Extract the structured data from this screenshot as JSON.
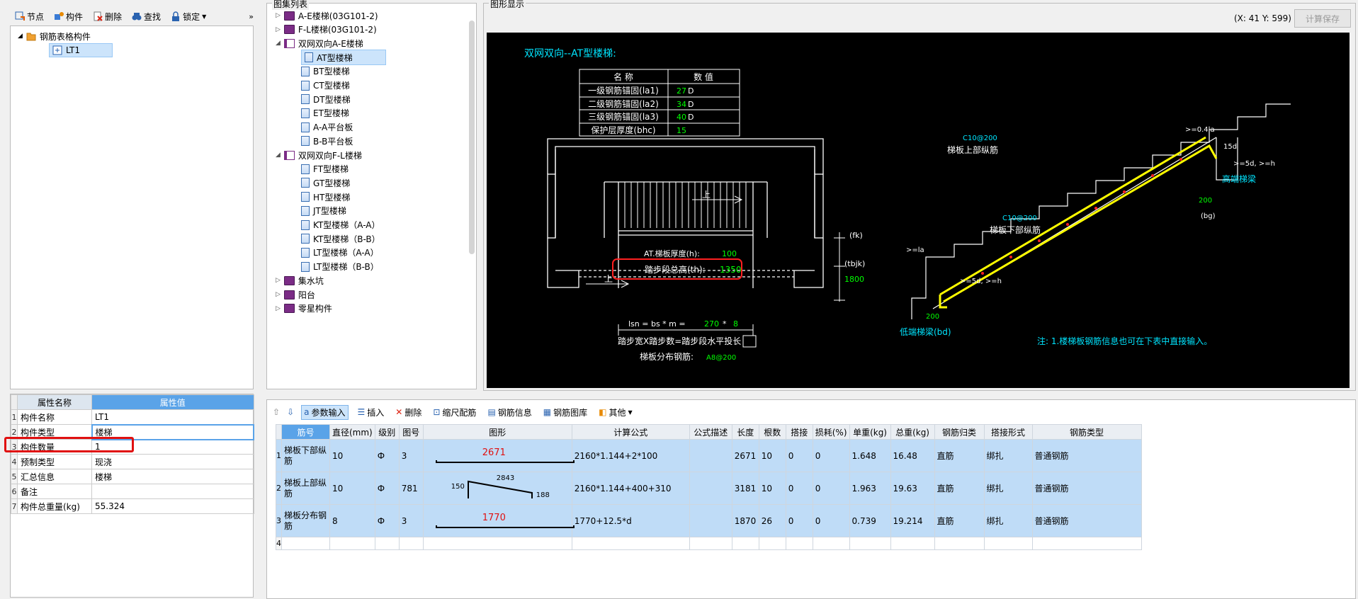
{
  "toolbar": {
    "node": "节点",
    "component": "构件",
    "delete": "删除",
    "find": "查找",
    "lock": "锁定"
  },
  "tree": {
    "root": "钢筋表格构件",
    "child": "LT1"
  },
  "props": {
    "col_name": "属性名称",
    "col_value": "属性值",
    "rows": [
      {
        "n": "1",
        "name": "构件名称",
        "value": "LT1"
      },
      {
        "n": "2",
        "name": "构件类型",
        "value": "楼梯"
      },
      {
        "n": "3",
        "name": "构件数量",
        "value": "1"
      },
      {
        "n": "4",
        "name": "预制类型",
        "value": "现浇"
      },
      {
        "n": "5",
        "name": "汇总信息",
        "value": "楼梯"
      },
      {
        "n": "6",
        "name": "备注",
        "value": ""
      },
      {
        "n": "7",
        "name": "构件总重量(kg)",
        "value": "55.324"
      }
    ]
  },
  "atlas": {
    "title": "图集列表",
    "items": [
      {
        "label": "A-E楼梯(03G101-2)",
        "kind": "book"
      },
      {
        "label": "F-L楼梯(03G101-2)",
        "kind": "book"
      },
      {
        "label": "双网双向A-E楼梯",
        "kind": "book-open"
      },
      {
        "label": "AT型楼梯",
        "kind": "doc",
        "selected": true
      },
      {
        "label": "BT型楼梯",
        "kind": "doc"
      },
      {
        "label": "CT型楼梯",
        "kind": "doc"
      },
      {
        "label": "DT型楼梯",
        "kind": "doc"
      },
      {
        "label": "ET型楼梯",
        "kind": "doc"
      },
      {
        "label": "A-A平台板",
        "kind": "doc"
      },
      {
        "label": "B-B平台板",
        "kind": "doc"
      },
      {
        "label": "双网双向F-L楼梯",
        "kind": "book-open"
      },
      {
        "label": "FT型楼梯",
        "kind": "doc"
      },
      {
        "label": "GT型楼梯",
        "kind": "doc"
      },
      {
        "label": "HT型楼梯",
        "kind": "doc"
      },
      {
        "label": "JT型楼梯",
        "kind": "doc"
      },
      {
        "label": "KT型楼梯（A-A）",
        "kind": "doc"
      },
      {
        "label": "KT型楼梯（B-B）",
        "kind": "doc"
      },
      {
        "label": "LT型楼梯（A-A）",
        "kind": "doc"
      },
      {
        "label": "LT型楼梯（B-B）",
        "kind": "doc"
      },
      {
        "label": "集水坑",
        "kind": "book"
      },
      {
        "label": "阳台",
        "kind": "book"
      },
      {
        "label": "零星构件",
        "kind": "book"
      }
    ]
  },
  "graphic": {
    "title": "图形显示",
    "coords": "(X: 41 Y: 599)",
    "save": "计算保存"
  },
  "drawing": {
    "heading": "双网双向--AT型楼梯:",
    "table_h_name": "名  称",
    "table_h_value": "数  值",
    "table_rows": [
      {
        "name": "一级钢筋锚固(la1)",
        "value": "27",
        "unit": "D"
      },
      {
        "name": "二级钢筋锚固(la2)",
        "value": "34",
        "unit": "D"
      },
      {
        "name": "三级钢筋锚固(la3)",
        "value": "40",
        "unit": "D"
      },
      {
        "name": "保护层厚度(bhc)",
        "value": "15",
        "unit": ""
      }
    ],
    "thick_label": "AT.梯板厚度(h):",
    "thick_value": "100",
    "height_label": "踏步段总高(th):",
    "height_value": "1350",
    "lsn_label": "lsn = bs * m =",
    "lsn_bs": "270",
    "lsn_star": "*",
    "lsn_m": "8",
    "lsn_caption": "踏步宽X踏步数=踏步段水平投长",
    "dist_label": "梯板分布钢筋:",
    "dist_value": "A8@200",
    "fk": "(fk)",
    "tbjk": "(tbjk)",
    "v1800": "1800",
    "up1": "上",
    "up2": "上",
    "top_rebar_spec": "C10@200",
    "top_rebar_label": "梯板上部纵筋",
    "bot_rebar_spec": "C10@200",
    "bot_rebar_label": "梯板下部纵筋",
    "ann_04la": ">=0.4la",
    "ann_15d": "15d",
    "ann_5d_h_top": ">=5d, >=h",
    "high_beam": "高端梯梁",
    "v200_top": "200",
    "bg": "(bg)",
    "ann_la": ">=la",
    "ann_5d_h_bot": ">=5d, >=h",
    "v200_bot": "200",
    "low_beam": "低端梯梁(bd)",
    "note": "注: 1.楼梯板钢筋信息也可在下表中直接输入。"
  },
  "grid_tools": {
    "param_input": "参数输入",
    "insert": "插入",
    "delete": "删除",
    "scale": "缩尺配筋",
    "info": "钢筋信息",
    "lib": "钢筋图库",
    "other": "其他"
  },
  "grid": {
    "headers": [
      "筋号",
      "直径(mm)",
      "级别",
      "图号",
      "图形",
      "计算公式",
      "公式描述",
      "长度",
      "根数",
      "搭接",
      "损耗(%)",
      "单重(kg)",
      "总重(kg)",
      "钢筋归类",
      "搭接形式",
      "钢筋类型"
    ],
    "rows": [
      {
        "n": "1",
        "name": "梯板下部纵筋",
        "dia": "10",
        "grade": "Ф",
        "fig": "3",
        "shape": "2671",
        "formula": "2160*1.144+2*100",
        "desc": "",
        "len": "2671",
        "count": "10",
        "lap": "0",
        "loss": "0",
        "unit": "1.648",
        "total": "16.48",
        "cat": "直筋",
        "lapform": "绑扎",
        "type": "普通钢筋"
      },
      {
        "n": "2",
        "name": "梯板上部纵筋",
        "dia": "10",
        "grade": "Ф",
        "fig": "781",
        "shape_a": "150",
        "shape_b": "2843",
        "shape_c": "188",
        "formula": "2160*1.144+400+310",
        "desc": "",
        "len": "3181",
        "count": "10",
        "lap": "0",
        "loss": "0",
        "unit": "1.963",
        "total": "19.63",
        "cat": "直筋",
        "lapform": "绑扎",
        "type": "普通钢筋"
      },
      {
        "n": "3",
        "name": "梯板分布钢筋",
        "dia": "8",
        "grade": "Ф",
        "fig": "3",
        "shape": "1770",
        "formula": "1770+12.5*d",
        "desc": "",
        "len": "1870",
        "count": "26",
        "lap": "0",
        "loss": "0",
        "unit": "0.739",
        "total": "19.214",
        "cat": "直筋",
        "lapform": "绑扎",
        "type": "普通钢筋"
      },
      {
        "n": "4",
        "name": "",
        "dia": "",
        "grade": "",
        "fig": "",
        "formula": "",
        "desc": "",
        "len": "",
        "count": "",
        "lap": "",
        "loss": "",
        "unit": "",
        "total": "",
        "cat": "",
        "lapform": "",
        "type": ""
      }
    ]
  },
  "colors": {
    "cyan": "#00e5ff",
    "green": "#00ff00",
    "yellow": "#ffff00",
    "red": "#ff2020",
    "select": "#bfdcf7"
  }
}
